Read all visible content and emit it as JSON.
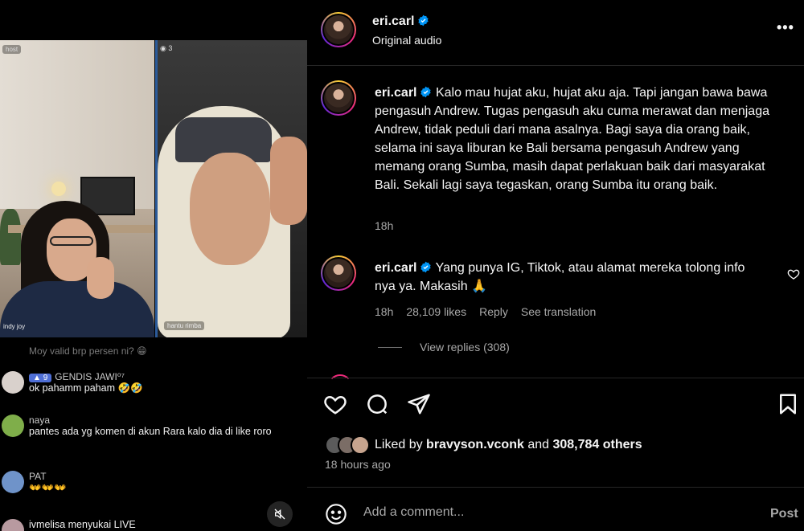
{
  "video": {
    "host_label": "host",
    "viewer_count": "3",
    "left_name": "indy joy",
    "right_name": "hantu rimba",
    "chat": {
      "faded_line": "Moy valid brp persen ni? 😁",
      "messages": [
        {
          "user": "GENDIS JAWI⁰⁷",
          "badge": "9",
          "text": "ok pahamm paham 🤣🤣"
        },
        {
          "user": "naya",
          "text": "pantes ada yg komen di akun Rara kalo dia di like roro"
        },
        {
          "user": "PAT",
          "text": "👐👐👐"
        },
        {
          "user": "ivmelisa",
          "text": "menyukai LIVE"
        }
      ]
    }
  },
  "header": {
    "username": "eri.carl",
    "subtitle": "Original audio",
    "more_icon": "more-horizontal-icon"
  },
  "caption": {
    "username": "eri.carl",
    "text": "Kalo mau hujat aku, hujat aku aja. Tapi jangan bawa bawa pengasuh Andrew. Tugas pengasuh aku cuma merawat dan menjaga Andrew, tidak peduli dari mana asalnya. Bagi saya dia orang baik, selama ini saya liburan ke Bali bersama pengasuh Andrew yang memang orang Sumba, masih dapat perlakuan baik dari masyarakat Bali. Sekali lagi saya tegaskan, orang Sumba itu orang baik.",
    "time": "18h"
  },
  "comment": {
    "username": "eri.carl",
    "text": "Yang punya IG, Tiktok, atau alamat mereka tolong info nya ya. Makasih 🙏",
    "time": "18h",
    "likes": "28,109 likes",
    "reply": "Reply",
    "translate": "See translation",
    "view_replies": "View replies (308)"
  },
  "likes": {
    "prefix": "Liked by",
    "user": "bravyson.vconk",
    "and": "and",
    "others": "308,784 others",
    "time_ago": "18 hours ago"
  },
  "add_comment": {
    "placeholder": "Add a comment...",
    "post_label": "Post"
  },
  "colors": {
    "background": "#000000",
    "verified": "#0095f6",
    "muted_text": "#a8a8a8"
  }
}
